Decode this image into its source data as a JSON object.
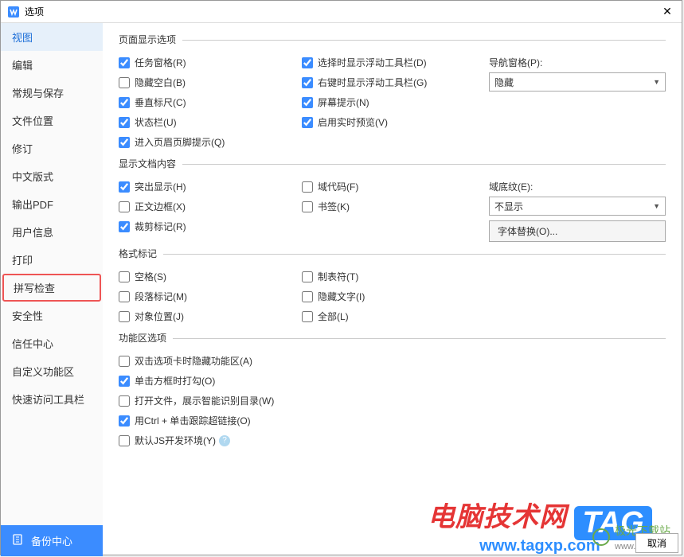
{
  "titlebar": {
    "title": "选项",
    "close": "✕"
  },
  "sidebar": {
    "items": [
      "视图",
      "编辑",
      "常规与保存",
      "文件位置",
      "修订",
      "中文版式",
      "输出PDF",
      "用户信息",
      "打印",
      "拼写检查",
      "安全性",
      "信任中心",
      "自定义功能区",
      "快速访问工具栏"
    ],
    "backup": "备份中心"
  },
  "groups": {
    "page_display": {
      "title": "页面显示选项",
      "col1": [
        {
          "label": "任务窗格(R)",
          "checked": true,
          "key": "r"
        },
        {
          "label": "隐藏空白(B)",
          "checked": false,
          "key": "b"
        },
        {
          "label": "垂直标尺(C)",
          "checked": true,
          "key": "c"
        },
        {
          "label": "状态栏(U)",
          "checked": true,
          "key": "u"
        },
        {
          "label": "进入页眉页脚提示(Q)",
          "checked": true,
          "key": "q"
        }
      ],
      "col2": [
        {
          "label": "选择时显示浮动工具栏(D)",
          "checked": true,
          "key": "d"
        },
        {
          "label": "右键时显示浮动工具栏(G)",
          "checked": true,
          "key": "g"
        },
        {
          "label": "屏幕提示(N)",
          "checked": true,
          "key": "n"
        },
        {
          "label": "启用实时预览(V)",
          "checked": true,
          "key": "v"
        }
      ],
      "nav_label": "导航窗格(P):",
      "nav_value": "隐藏"
    },
    "doc_content": {
      "title": "显示文档内容",
      "col1": [
        {
          "label": "突出显示(H)",
          "checked": true,
          "key": "h"
        },
        {
          "label": "正文边框(X)",
          "checked": false,
          "key": "x"
        },
        {
          "label": "裁剪标记(R)",
          "checked": true,
          "key": "r2"
        }
      ],
      "col2": [
        {
          "label": "域代码(F)",
          "checked": false,
          "key": "f"
        },
        {
          "label": "书签(K)",
          "checked": false,
          "key": "k"
        }
      ],
      "shade_label": "域底纹(E):",
      "shade_value": "不显示",
      "font_sub_btn": "字体替换(O)..."
    },
    "format_marks": {
      "title": "格式标记",
      "col1": [
        {
          "label": "空格(S)",
          "checked": false,
          "key": "s"
        },
        {
          "label": "段落标记(M)",
          "checked": false,
          "key": "m"
        },
        {
          "label": "对象位置(J)",
          "checked": false,
          "key": "j"
        }
      ],
      "col2": [
        {
          "label": "制表符(T)",
          "checked": false,
          "key": "t"
        },
        {
          "label": "隐藏文字(I)",
          "checked": false,
          "key": "i"
        },
        {
          "label": "全部(L)",
          "checked": false,
          "key": "l"
        }
      ]
    },
    "ribbon": {
      "title": "功能区选项",
      "items": [
        {
          "label": "双击选项卡时隐藏功能区(A)",
          "checked": false,
          "key": "a"
        },
        {
          "label": "单击方框时打勾(O)",
          "checked": true,
          "key": "o"
        },
        {
          "label": "打开文件，展示智能识别目录(W)",
          "checked": false,
          "key": "w"
        },
        {
          "label": "用Ctrl + 单击跟踪超链接(O)",
          "checked": true,
          "key": "o2"
        },
        {
          "label": "默认JS开发环境(Y)",
          "checked": false,
          "key": "y",
          "help": true
        }
      ]
    }
  },
  "footer": {
    "cancel": "取消"
  },
  "watermark": {
    "line1": "电脑技术网",
    "tag": "TAG",
    "url": "www.tagxp.com",
    "site2a": "极光下载站",
    "site2b": "www.xz7.com"
  }
}
